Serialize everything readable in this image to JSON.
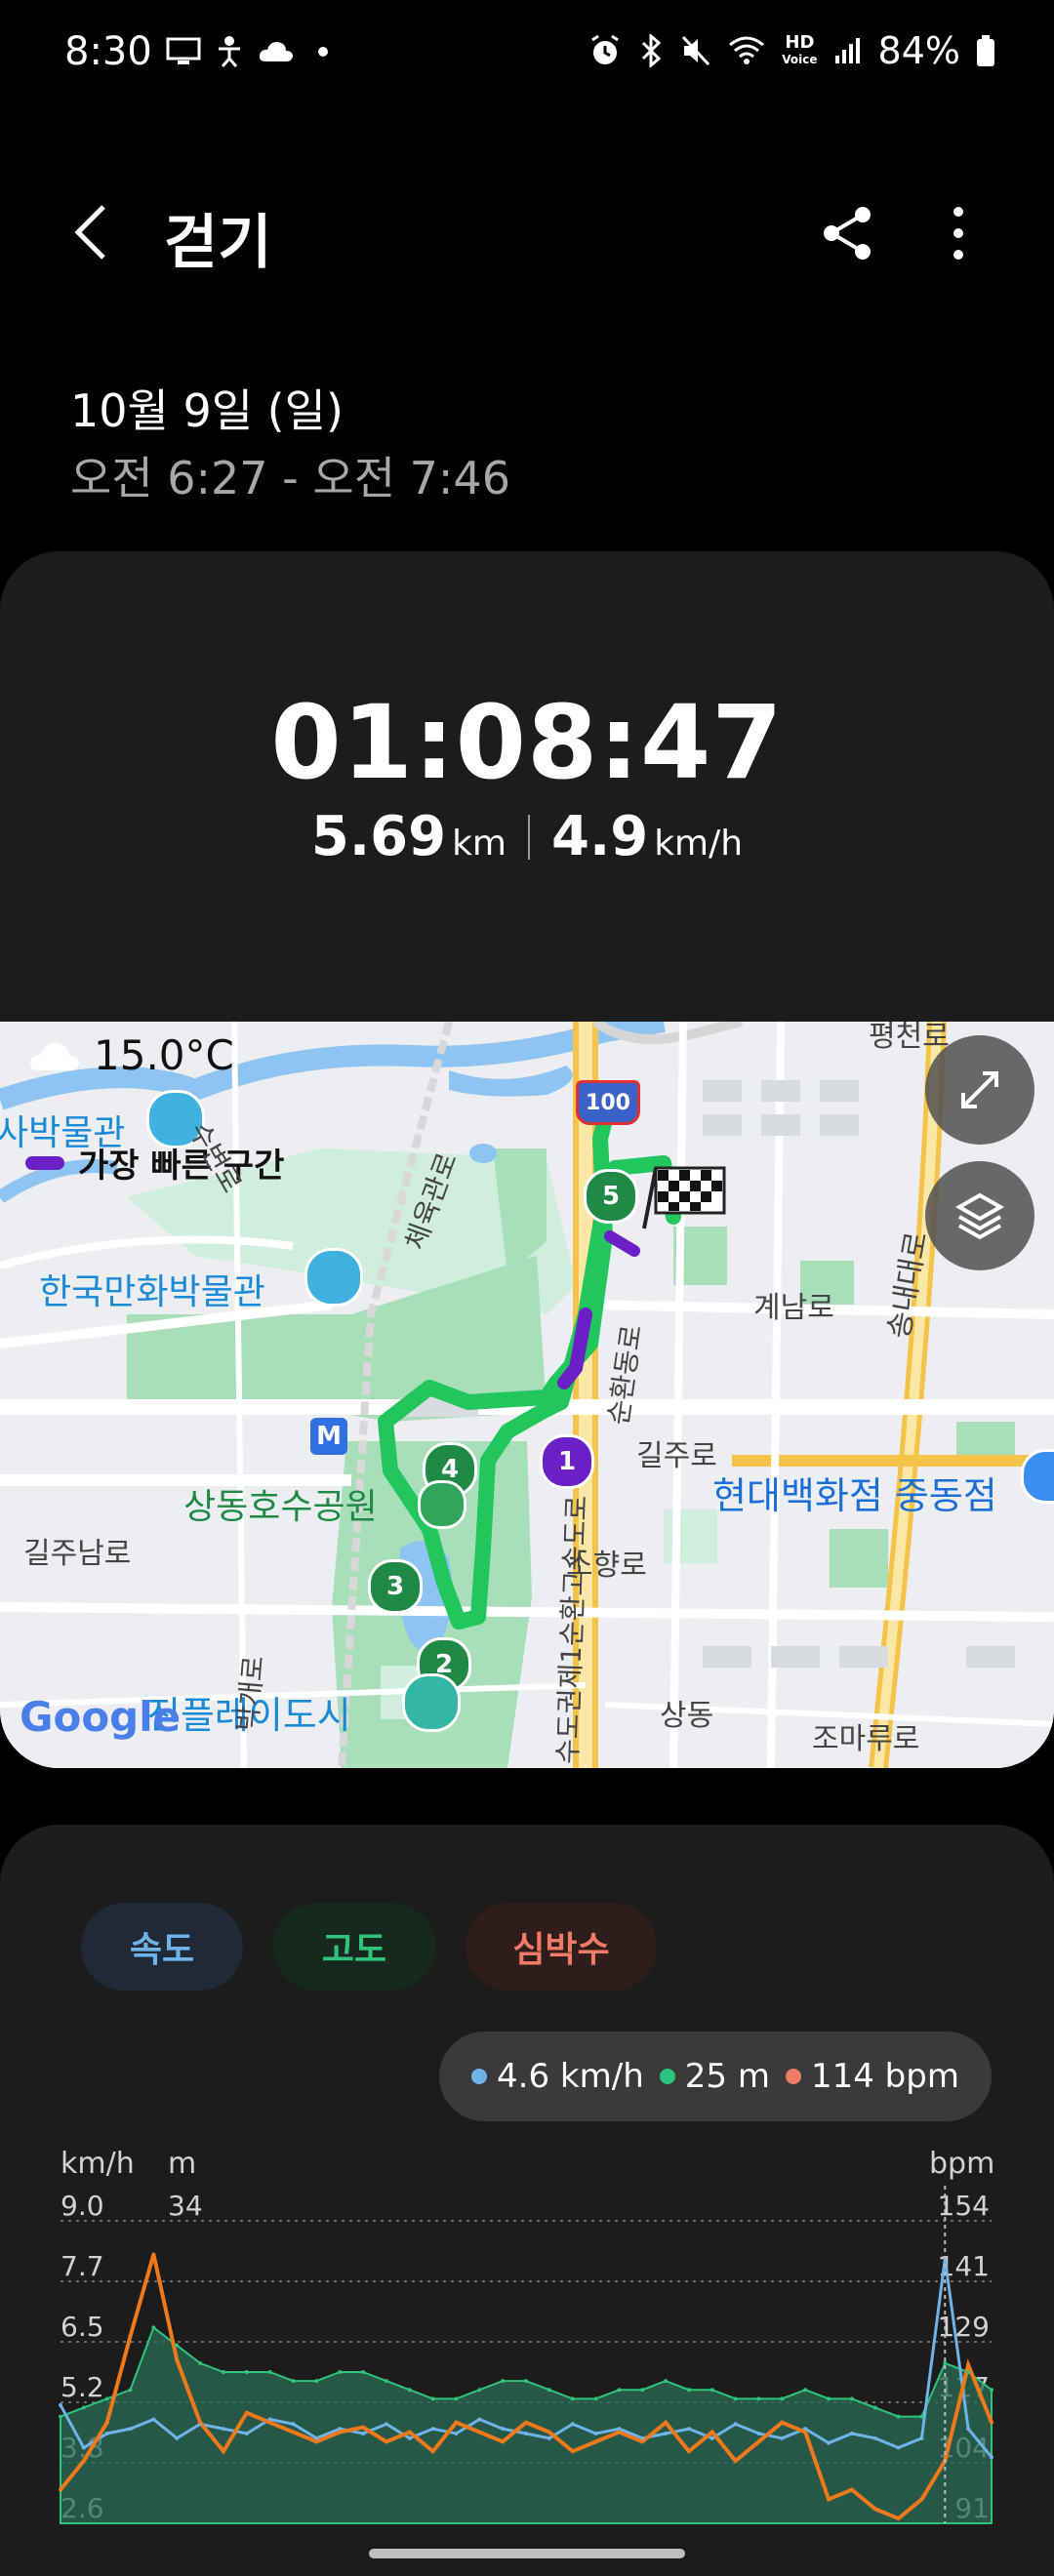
{
  "status_bar": {
    "time": "8:30",
    "battery": "84%",
    "hd_voice": "HD"
  },
  "app_bar": {
    "title": "걷기"
  },
  "session": {
    "date": "10월 9일 (일)",
    "time_range": "오전 6:27 - 오전 7:46"
  },
  "summary": {
    "duration": "01:08:47",
    "distance_value": "5.69",
    "distance_unit": "km",
    "speed_value": "4.9",
    "speed_unit": "km/h"
  },
  "map": {
    "temperature": "15.0°C",
    "legend_fastest": "가장 빠른 구간",
    "labels": {
      "museum_partial": "사박물관",
      "comic_museum": "한국만화박물관",
      "lake_park": "상동호수공원",
      "hyundai": "현대백화점 중동점",
      "jinpl": "진플레이도시",
      "gilju_ro": "길주로",
      "gilju_nam_ro": "길주남로",
      "gyenam_ro": "계남로",
      "sohyang_ro": "소향로",
      "sangdong": "상동",
      "joma_ru_ro": "조마루로",
      "pyeongcheon_ro": "평천로",
      "songnae_daero": "송내대로",
      "sudo_ring": "수도권제1순환고속도로",
      "sunhwan_ro": "순환동로",
      "jeyuk_ro": "체육관로",
      "subyeon_ro": "수변로",
      "bakgae_ro": "박개로",
      "highway_shield": "100",
      "metro": "M",
      "google": "Google"
    },
    "markers": [
      "1",
      "2",
      "3",
      "4",
      "5"
    ]
  },
  "chart_tabs": {
    "speed": "속도",
    "altitude": "고도",
    "heart_rate": "심박수"
  },
  "chart_legend": {
    "speed": "4.6 km/h",
    "altitude": "25 m",
    "heart_rate": "114 bpm"
  },
  "chart_axes": {
    "left_unit": "km/h",
    "mid_unit": "m",
    "right_unit": "bpm",
    "speed_ticks": [
      "9.0",
      "7.7",
      "6.5",
      "5.2",
      "3.8",
      "2.6"
    ],
    "altitude_ticks": [
      "34"
    ],
    "bpm_ticks": [
      "154",
      "141",
      "129",
      "117",
      "104",
      "91"
    ]
  },
  "colors": {
    "speed": "#6fb3e8",
    "altitude": "#2fc47b",
    "heart_rate": "#f07a66",
    "route": "#21c65c",
    "fastest": "#6b1fc6",
    "hr_line": "#f07818",
    "speed_line": "#f2d31a"
  },
  "chart_data": {
    "type": "line",
    "x": [
      0,
      1,
      2,
      3,
      4,
      5,
      6,
      7,
      8,
      9,
      10,
      11,
      12,
      13,
      14,
      15,
      16,
      17,
      18,
      19,
      20,
      21,
      22,
      23,
      24,
      25,
      26,
      27,
      28,
      29,
      30,
      31,
      32,
      33,
      34,
      35,
      36,
      37,
      38,
      39,
      40
    ],
    "series": [
      {
        "name": "",
        "axis": "speed",
        "values": [
          5.1,
          4.2,
          4.5,
          4.6,
          4.8,
          4.4,
          4.7,
          4.6,
          4.5,
          4.8,
          4.7,
          4.4,
          4.6,
          4.5,
          4.7,
          4.4,
          4.6,
          4.5,
          4.8,
          4.6,
          4.5,
          4.4,
          4.7,
          4.5,
          4.6,
          4.4,
          4.5,
          4.6,
          4.4,
          4.7,
          4.5,
          4.4,
          4.6,
          4.3,
          4.5,
          4.4,
          4.2,
          4.4,
          8.2,
          4.6,
          4.0
        ]
      },
      {
        "name": "",
        "axis": "altitude",
        "values": [
          12,
          13,
          14,
          15,
          22,
          20,
          18,
          17,
          17,
          17,
          16,
          16,
          17,
          17,
          16,
          15,
          14,
          14,
          15,
          16,
          16,
          15,
          14,
          14,
          15,
          15,
          16,
          15,
          15,
          14,
          14,
          14,
          15,
          14,
          14,
          13,
          12,
          12,
          18,
          17,
          15
        ]
      },
      {
        "name": "",
        "axis": "heart_rate",
        "values": [
          98,
          104,
          112,
          130,
          147,
          125,
          112,
          106,
          114,
          112,
          110,
          108,
          110,
          111,
          108,
          110,
          106,
          112,
          110,
          108,
          112,
          110,
          106,
          108,
          110,
          108,
          112,
          106,
          110,
          104,
          108,
          112,
          110,
          96,
          98,
          94,
          92,
          96,
          104,
          124,
          112
        ]
      }
    ]
  }
}
